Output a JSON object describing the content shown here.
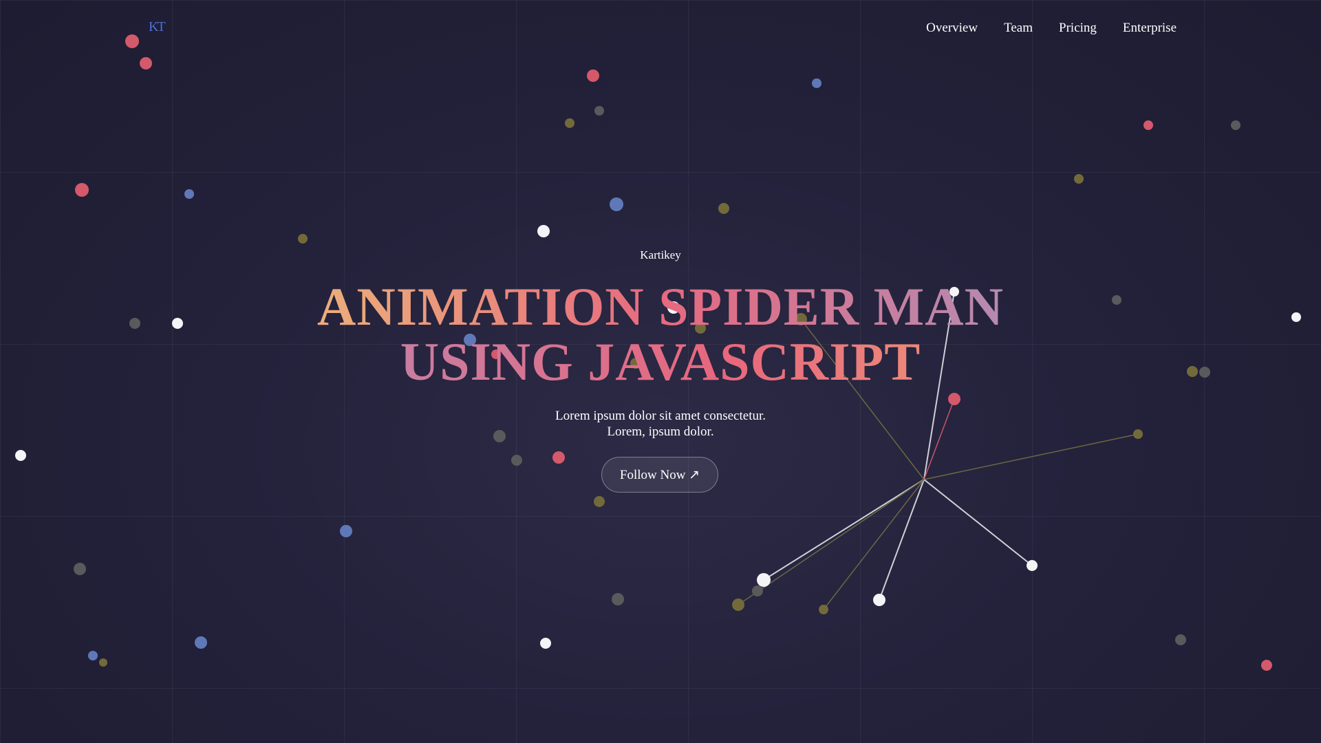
{
  "brand": {
    "logo_text": "KT"
  },
  "nav": {
    "items": [
      {
        "label": "Overview"
      },
      {
        "label": "Team"
      },
      {
        "label": "Pricing"
      },
      {
        "label": "Enterprise"
      }
    ]
  },
  "hero": {
    "eyebrow": "Kartikey",
    "title_line1": "ANIMATION SPIDER MAN",
    "title_line2": "USING JAVASCRIPT",
    "description_line1": "Lorem ipsum dolor sit amet consectetur.",
    "description_line2": "Lorem, ipsum dolor.",
    "cta_label": "Follow Now ↗"
  },
  "colors": {
    "background": "#24223b",
    "particle_red": "#d4596b",
    "particle_blue": "#5f79b8",
    "particle_olive": "#726a3a",
    "particle_gray": "#5a5a5c",
    "particle_white": "#f4f4f6",
    "logo": "#4f6fd8"
  }
}
